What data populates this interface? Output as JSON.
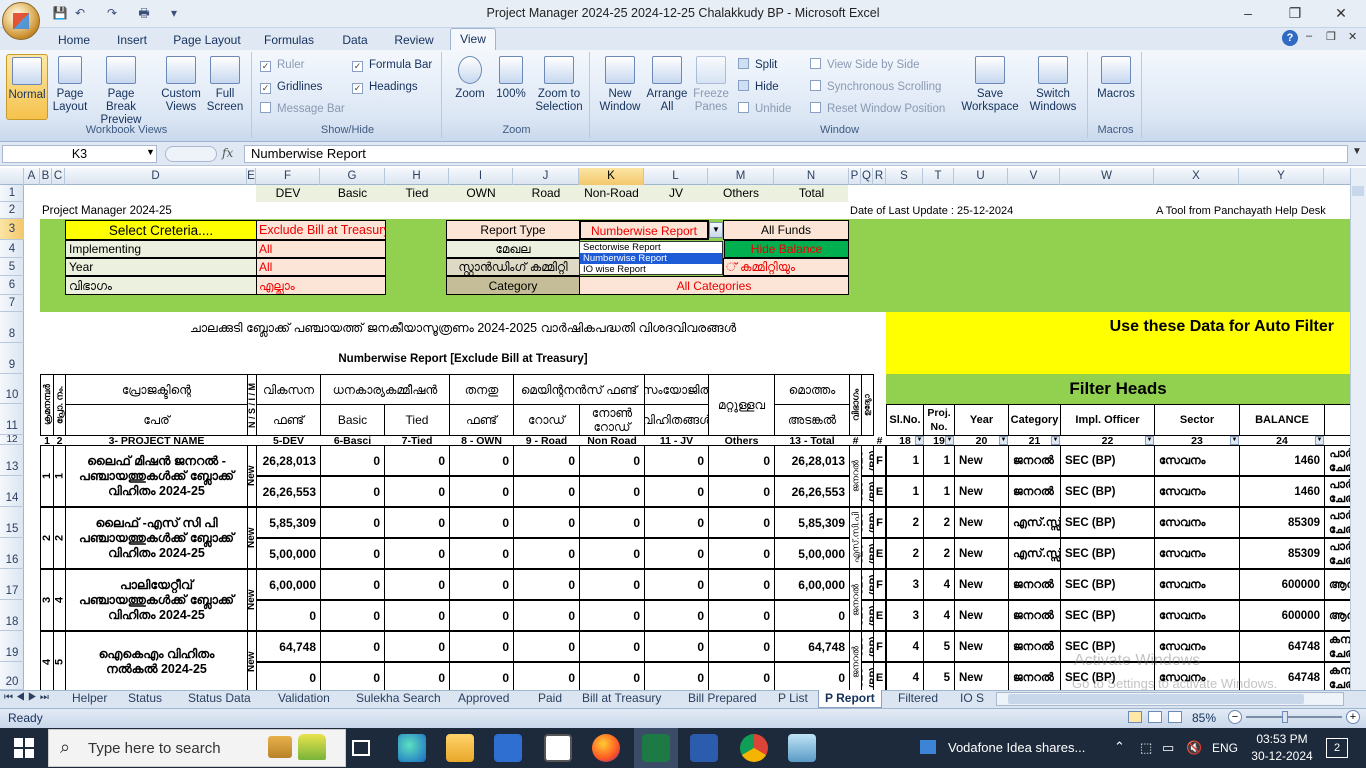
{
  "window": {
    "title": "Project Manager 2024-25  2024-12-25 Chalakkudy BP  -  Microsoft Excel"
  },
  "ribbon": {
    "tabs": [
      "Home",
      "Insert",
      "Page Layout",
      "Formulas",
      "Data",
      "Review",
      "View"
    ],
    "active_tab": "View",
    "workbook_views": {
      "label": "Workbook Views",
      "normal": "Normal",
      "page_layout": "Page Layout",
      "page_break": "Page Break Preview",
      "custom": "Custom Views",
      "full": "Full Screen"
    },
    "show_hide": {
      "label": "Show/Hide",
      "ruler": "Ruler",
      "gridlines": "Gridlines",
      "message_bar": "Message Bar",
      "formula_bar": "Formula Bar",
      "headings": "Headings"
    },
    "zoom": {
      "label": "Zoom",
      "zoom": "Zoom",
      "hundred": "100%",
      "to_selection": "Zoom to Selection"
    },
    "window": {
      "label": "Window",
      "new_window": "New Window",
      "arrange_all": "Arrange All",
      "freeze": "Freeze Panes",
      "split": "Split",
      "hide": "Hide",
      "unhide": "Unhide",
      "side_by_side": "View Side by Side",
      "sync_scroll": "Synchronous Scrolling",
      "reset_pos": "Reset Window Position",
      "save_ws": "Save Workspace",
      "switch": "Switch Windows"
    },
    "macros": {
      "label": "Macros",
      "macros": "Macros"
    }
  },
  "formula_bar": {
    "name_box": "K3",
    "fx": "fx",
    "content": "Numberwise Report"
  },
  "columns": [
    "A",
    "B",
    "C",
    "D",
    "E",
    "F",
    "G",
    "H",
    "I",
    "J",
    "K",
    "L",
    "M",
    "N",
    "P",
    "Q",
    "R",
    "S",
    "T",
    "U",
    "V",
    "W",
    "X",
    "Y"
  ],
  "rows": [
    "1",
    "2",
    "3",
    "4",
    "5",
    "6",
    "7",
    "8",
    "9",
    "10",
    "11",
    "12",
    "13",
    "14",
    "15",
    "16",
    "17",
    "18",
    "19",
    "20"
  ],
  "sheet": {
    "row1": [
      "DEV",
      "Basic",
      "Tied",
      "OWN",
      "Road",
      "Non-Road",
      "JV",
      "Others",
      "Total"
    ],
    "pm_title": "Project Manager 2024-25",
    "last_update": "Date of Last Update : 25-12-2024",
    "tool_from": "A Tool from Panchayath Help Desk",
    "select_criteria": "Select Creteria....",
    "exclude_bill": "Exclude Bill at Treasury",
    "implementing": "Implementing",
    "year": "Year",
    "vibhagam": "വിഭാഗം",
    "all1": "All",
    "all2": "All",
    "ellam": "എല്ലാം",
    "report_type": "Report Type",
    "report_value": "Numberwise Report",
    "all_funds": "All Funds",
    "mekhala": "മേഖല",
    "standing": "സ്റ്റാൻഡിംഗ് കമ്മിറ്റി",
    "hide_balance": "Hide Balance",
    "committee_all": "് കമ്മിറ്റിയും",
    "category": "Category",
    "all_categories": "All Categories",
    "main_title": "ചാലക്കുടി ബ്ലോക്ക് പഞ്ചായത്ത് ജനകീയാസൂത്രണം 2024-2025 വാർഷികപദ്ധതി വിശദവിവരങ്ങൾ",
    "sub_title": "Numberwise Report [Exclude Bill at Treasury]",
    "use_data": "Use these Data for Auto Filter",
    "filter_heads": "Filter Heads"
  },
  "dropdown": {
    "options": [
      "Sectorwise Report",
      "Numberwise Report",
      "IO wise Report"
    ],
    "selected": "Numberwise Report"
  },
  "table": {
    "h10": {
      "krama": "ക്രമനമ്പർ",
      "proj_no": "പ്രോ. നം.",
      "projectinte": "പ്രോജക്ടിന്റെ",
      "nism": "N / S / I / M",
      "vikasana": "വികസന",
      "dhana": "ധനകാര്യകമ്മീഷൻ",
      "thanathu": "തനതു",
      "maint": "മെയിന്റനൻസ് ഫണ്ട്",
      "samyo": "സംയോജിത",
      "mattu": "മറ്റുള്ളവ",
      "motham": "മൊത്തം",
      "vibhagam": "വിഭാഗം",
      "nirvahana": "നിർവഹണ ഉദ്യോ Fund/Exp."
    },
    "h11": {
      "peru": "പേര്",
      "fund": "ഫണ്ട്",
      "basic": "Basic",
      "tied": "Tied",
      "own_fund": "ഫണ്ട്",
      "road": "റോഡ്",
      "nonroad": "നോൺ റോഡ്",
      "vihitham": "വിഹിതങ്ങൾ",
      "adankal": "അടങ്കൽ"
    },
    "h12": [
      "1",
      "2",
      "3- PROJECT NAME",
      "",
      "5-DEV",
      "6-Basci",
      "7-Tied",
      "8 - OWN",
      "9 - Road",
      "Non Road",
      "11 - JV",
      "Others",
      "13 - Total",
      "#",
      "#"
    ],
    "filter_h11": [
      "Sl.No.",
      "Proj. No.",
      "Year",
      "Category",
      "Impl. Officer",
      "Sector",
      "BALANCE"
    ],
    "filter_h12": [
      "18",
      "19",
      "20",
      "21",
      "22",
      "23",
      "24"
    ],
    "projects": [
      {
        "sl": "1",
        "no": "1",
        "name": "ലൈഫ് മിഷൻ ജനറൽ - പഞ്ചായത്തുകൾക്ക് ബ്ലോക്ക് വിഹിതം 2024-25",
        "status": "New",
        "sec": "ജനറൽ",
        "rows": [
          {
            "dev": "26,28,013",
            "basic": "0",
            "tied": "0",
            "own": "0",
            "road": "0",
            "nonroad": "0",
            "jv": "0",
            "others": "0",
            "total": "26,28,013",
            "fe": "F",
            "s": "1",
            "t": "1",
            "year": "New",
            "cat": "ജനറൽ",
            "impl": "SEC (BP)",
            "sector": "സേവനം",
            "bal": "1460",
            "y": "പാർ ചേര"
          },
          {
            "dev": "26,26,553",
            "basic": "0",
            "tied": "0",
            "own": "0",
            "road": "0",
            "nonroad": "0",
            "jv": "0",
            "others": "0",
            "total": "26,26,553",
            "fe": "E",
            "s": "1",
            "t": "1",
            "year": "New",
            "cat": "ജനറൽ",
            "impl": "SEC (BP)",
            "sector": "സേവനം",
            "bal": "1460",
            "y": "പാർ ചേര"
          }
        ]
      },
      {
        "sl": "2",
        "no": "2",
        "name": "ലൈഫ് -എസ് സി പി പഞ്ചായത്തുകൾക്ക് ബ്ലോക്ക് വിഹിതം 2024-25",
        "status": "New",
        "sec": "എസ്.സി.പി",
        "rows": [
          {
            "dev": "5,85,309",
            "basic": "0",
            "tied": "0",
            "own": "0",
            "road": "0",
            "nonroad": "0",
            "jv": "0",
            "others": "0",
            "total": "5,85,309",
            "fe": "F",
            "s": "2",
            "t": "2",
            "year": "New",
            "cat": "എസ്.സ്സ്",
            "impl": "SEC (BP)",
            "sector": "സേവനം",
            "bal": "85309",
            "y": "പാർ ചേര"
          },
          {
            "dev": "5,00,000",
            "basic": "0",
            "tied": "0",
            "own": "0",
            "road": "0",
            "nonroad": "0",
            "jv": "0",
            "others": "0",
            "total": "5,00,000",
            "fe": "E",
            "s": "2",
            "t": "2",
            "year": "New",
            "cat": "എസ്.സ്സ്",
            "impl": "SEC (BP)",
            "sector": "സേവനം",
            "bal": "85309",
            "y": "പാർ ചേര"
          }
        ]
      },
      {
        "sl": "3",
        "no": "4",
        "name": "പാലിയേറ്റീവ് പഞ്ചായത്തുകൾക്ക് ബ്ലോക്ക് വിഹിതം 2024-25",
        "status": "New",
        "sec": "ജനറൽ",
        "rows": [
          {
            "dev": "6,00,000",
            "basic": "0",
            "tied": "0",
            "own": "0",
            "road": "0",
            "nonroad": "0",
            "jv": "0",
            "others": "0",
            "total": "6,00,000",
            "fe": "F",
            "s": "3",
            "t": "4",
            "year": "New",
            "cat": "ജനറൽ",
            "impl": "SEC (BP)",
            "sector": "സേവനം",
            "bal": "600000",
            "y": "ആര"
          },
          {
            "dev": "0",
            "basic": "0",
            "tied": "0",
            "own": "0",
            "road": "0",
            "nonroad": "0",
            "jv": "0",
            "others": "0",
            "total": "0",
            "fe": "E",
            "s": "3",
            "t": "4",
            "year": "New",
            "cat": "ജനറൽ",
            "impl": "SEC (BP)",
            "sector": "സേവനം",
            "bal": "600000",
            "y": "ആര"
          }
        ]
      },
      {
        "sl": "4",
        "no": "5",
        "name": "ഐകെഎം വിഹിതം നൽകൽ 2024-25",
        "status": "New",
        "sec": "ജനറൽ",
        "rows": [
          {
            "dev": "64,748",
            "basic": "0",
            "tied": "0",
            "own": "0",
            "road": "0",
            "nonroad": "0",
            "jv": "0",
            "others": "0",
            "total": "64,748",
            "fe": "F",
            "s": "4",
            "t": "5",
            "year": "New",
            "cat": "ജനറൽ",
            "impl": "SEC (BP)",
            "sector": "സേവനം",
            "bal": "64748",
            "y": "കമ്പ ചേര"
          },
          {
            "dev": "0",
            "basic": "0",
            "tied": "0",
            "own": "0",
            "road": "0",
            "nonroad": "0",
            "jv": "0",
            "others": "0",
            "total": "0",
            "fe": "E",
            "s": "4",
            "t": "5",
            "year": "New",
            "cat": "ജനറൽ",
            "impl": "SEC (BP)",
            "sector": "സേവനം",
            "bal": "64748",
            "y": "കമ്പ ചേര"
          }
        ]
      }
    ]
  },
  "sheet_tabs": [
    "Helper",
    "Status",
    "Status Data",
    "Validation",
    "Sulekha Search",
    "Approved",
    "Paid",
    "Bill at Treasury",
    "Bill Prepared",
    "P List",
    "P Report",
    "Filtered",
    "IO S"
  ],
  "active_sheet": "P Report",
  "status": {
    "ready": "Ready",
    "zoom": "85%"
  },
  "watermark": {
    "line1": "Activate Windows",
    "line2": "Go to Settings to activate Windows."
  },
  "taskbar": {
    "search": "Type here to search",
    "notification": "Vodafone Idea shares...",
    "lang": "ENG",
    "time": "03:53 PM",
    "date": "30-12-2024",
    "badge": "2"
  }
}
